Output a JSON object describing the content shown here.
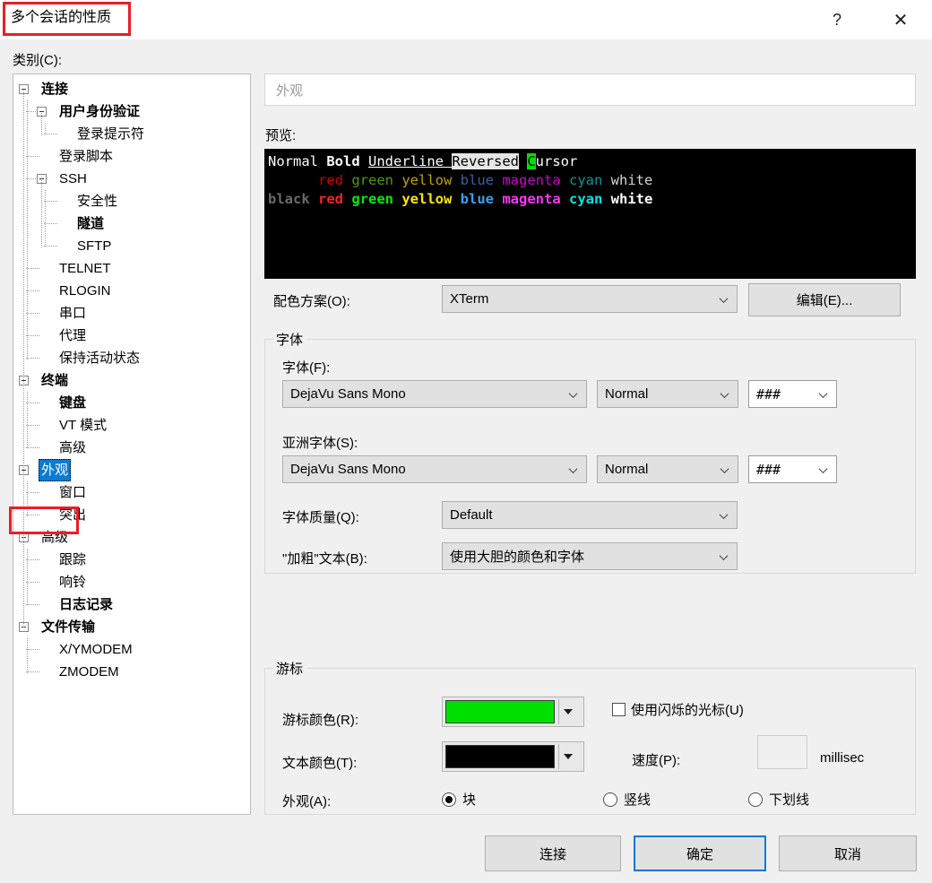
{
  "window": {
    "title": "多个会话的性质",
    "help_label": "?",
    "close_label": "✕",
    "annotation_color": "#ee1c25"
  },
  "category": {
    "label": "类别(C):",
    "items": [
      {
        "label": "连接",
        "depth": 0,
        "bold": true,
        "expander": true,
        "selected": false
      },
      {
        "label": "用户身份验证",
        "depth": 1,
        "bold": true,
        "expander": true,
        "selected": false
      },
      {
        "label": "登录提示符",
        "depth": 2,
        "bold": false,
        "expander": false,
        "selected": false
      },
      {
        "label": "登录脚本",
        "depth": 1,
        "bold": false,
        "expander": false,
        "selected": false
      },
      {
        "label": "SSH",
        "depth": 1,
        "bold": false,
        "expander": true,
        "selected": false
      },
      {
        "label": "安全性",
        "depth": 2,
        "bold": false,
        "expander": false,
        "selected": false
      },
      {
        "label": "隧道",
        "depth": 2,
        "bold": true,
        "expander": false,
        "selected": false
      },
      {
        "label": "SFTP",
        "depth": 2,
        "bold": false,
        "expander": false,
        "selected": false
      },
      {
        "label": "TELNET",
        "depth": 1,
        "bold": false,
        "expander": false,
        "selected": false
      },
      {
        "label": "RLOGIN",
        "depth": 1,
        "bold": false,
        "expander": false,
        "selected": false
      },
      {
        "label": "串口",
        "depth": 1,
        "bold": false,
        "expander": false,
        "selected": false
      },
      {
        "label": "代理",
        "depth": 1,
        "bold": false,
        "expander": false,
        "selected": false
      },
      {
        "label": "保持活动状态",
        "depth": 1,
        "bold": false,
        "expander": false,
        "selected": false
      },
      {
        "label": "终端",
        "depth": 0,
        "bold": true,
        "expander": true,
        "selected": false
      },
      {
        "label": "键盘",
        "depth": 1,
        "bold": true,
        "expander": false,
        "selected": false
      },
      {
        "label": "VT 模式",
        "depth": 1,
        "bold": false,
        "expander": false,
        "selected": false
      },
      {
        "label": "高级",
        "depth": 1,
        "bold": false,
        "expander": false,
        "selected": false
      },
      {
        "label": "外观",
        "depth": 0,
        "bold": false,
        "expander": true,
        "selected": true
      },
      {
        "label": "窗口",
        "depth": 1,
        "bold": false,
        "expander": false,
        "selected": false
      },
      {
        "label": "突出",
        "depth": 1,
        "bold": false,
        "expander": false,
        "selected": false
      },
      {
        "label": "高级",
        "depth": 0,
        "bold": false,
        "expander": true,
        "selected": false
      },
      {
        "label": "跟踪",
        "depth": 1,
        "bold": false,
        "expander": false,
        "selected": false
      },
      {
        "label": "响铃",
        "depth": 1,
        "bold": false,
        "expander": false,
        "selected": false
      },
      {
        "label": "日志记录",
        "depth": 1,
        "bold": true,
        "expander": false,
        "selected": false
      },
      {
        "label": "文件传输",
        "depth": 0,
        "bold": true,
        "expander": true,
        "selected": false
      },
      {
        "label": "X/YMODEM",
        "depth": 1,
        "bold": false,
        "expander": false,
        "selected": false
      },
      {
        "label": "ZMODEM",
        "depth": 1,
        "bold": false,
        "expander": false,
        "selected": false
      }
    ]
  },
  "page": {
    "header": "外观",
    "preview_label": "预览:",
    "preview": {
      "background": "#000000",
      "row1": [
        {
          "text": "Normal ",
          "style": "normal",
          "color": "#ffffff"
        },
        {
          "text": "Bold ",
          "style": "bold",
          "color": "#ffffff"
        },
        {
          "text": "Underline ",
          "style": "underline",
          "color": "#ffffff"
        },
        {
          "text": "Reversed",
          "style": "reversed",
          "color": "#000000",
          "background": "#e6e6e6"
        },
        {
          "text": " ",
          "style": "normal",
          "color": "#ffffff"
        },
        {
          "text": "C",
          "style": "cursor",
          "color": "#000000",
          "background": "#00e000"
        },
        {
          "text": "ursor",
          "style": "normal",
          "color": "#ffffff"
        }
      ],
      "row2": [
        {
          "text": "      ",
          "color": "#000000"
        },
        {
          "text": "red ",
          "color": "#cc0000"
        },
        {
          "text": "green ",
          "color": "#4e9a06"
        },
        {
          "text": "yellow ",
          "color": "#c4a000"
        },
        {
          "text": "blue ",
          "color": "#3465a4"
        },
        {
          "text": "magenta ",
          "color": "#cc00cc"
        },
        {
          "text": "cyan ",
          "color": "#06989a"
        },
        {
          "text": "white",
          "color": "#d3d7cf"
        }
      ],
      "row3": [
        {
          "text": "black ",
          "color": "#6a6a6a",
          "bold": true
        },
        {
          "text": "red ",
          "color": "#ef2929",
          "bold": true
        },
        {
          "text": "green ",
          "color": "#00ee00",
          "bold": true
        },
        {
          "text": "yellow ",
          "color": "#ffe600",
          "bold": true
        },
        {
          "text": "blue ",
          "color": "#32a2f0",
          "bold": true
        },
        {
          "text": "magenta ",
          "color": "#ff34ff",
          "bold": true
        },
        {
          "text": "cyan ",
          "color": "#00e5e5",
          "bold": true
        },
        {
          "text": "white",
          "color": "#ffffff",
          "bold": true
        }
      ]
    },
    "colour_scheme": {
      "label": "配色方案(O):",
      "value": "XTerm",
      "edit_button": "编辑(E)..."
    },
    "font_group": {
      "title": "字体",
      "font_label": "字体(F):",
      "font_value": "DejaVu Sans Mono",
      "font_style_value": "Normal",
      "font_size_value": "###",
      "asian_label": "亚洲字体(S):",
      "asian_value": "DejaVu Sans Mono",
      "asian_style_value": "Normal",
      "asian_size_value": "###",
      "quality_label": "字体质量(Q):",
      "quality_value": "Default",
      "bold_text_label": "\"加粗\"文本(B):",
      "bold_text_value": "使用大胆的颜色和字体"
    },
    "cursor_group": {
      "title": "游标",
      "cursor_colour_label": "游标颜色(R):",
      "cursor_colour_value": "#00e000",
      "text_colour_label": "文本颜色(T):",
      "text_colour_value": "#000000",
      "blink_label": "使用闪烁的光标(U)",
      "blink_checked": false,
      "speed_label": "速度(P):",
      "speed_value": "",
      "speed_unit": "millisec",
      "appearance_label": "外观(A):",
      "options": [
        {
          "label": "块",
          "selected": true
        },
        {
          "label": "竖线",
          "selected": false
        },
        {
          "label": "下划线",
          "selected": false
        }
      ]
    }
  },
  "footer": {
    "connect": "连接",
    "ok": "确定",
    "cancel": "取消"
  }
}
